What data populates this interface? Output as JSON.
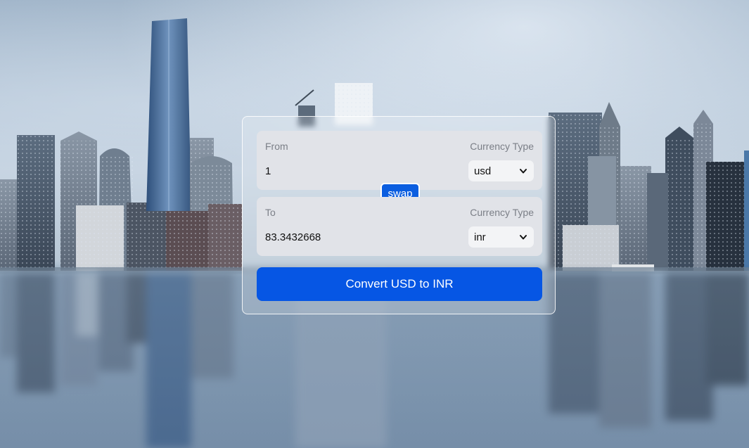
{
  "converter": {
    "from": {
      "label": "From",
      "type_label": "Currency Type",
      "amount": "1",
      "currency": "usd"
    },
    "to": {
      "label": "To",
      "type_label": "Currency Type",
      "amount": "83.3432668",
      "currency": "inr"
    },
    "swap_label": "swap",
    "convert_label": "Convert USD to INR"
  },
  "colors": {
    "accent": "#0656e4",
    "panel": "#e1e3e8",
    "select_bg": "#f3f4f6"
  },
  "icons": {
    "select_arrow": "chevron-down-icon"
  }
}
